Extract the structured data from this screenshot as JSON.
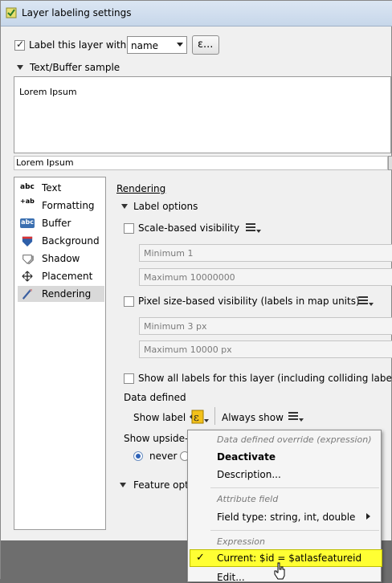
{
  "window": {
    "title": "Layer labeling settings"
  },
  "header": {
    "label_checkbox_text": "Label this layer with",
    "label_checked": true,
    "field_value": "name",
    "expression_button_label": "ε..."
  },
  "sample": {
    "section_title": "Text/Buffer sample",
    "text": "Lorem Ipsum",
    "line_text": "Lorem Ipsum"
  },
  "sidebar": {
    "items": [
      {
        "label": "Text",
        "icon": "text-icon",
        "icon_text": "abc"
      },
      {
        "label": "Formatting",
        "icon": "formatting-icon",
        "icon_text": "+ab"
      },
      {
        "label": "Buffer",
        "icon": "buffer-icon",
        "icon_text": "abc"
      },
      {
        "label": "Background",
        "icon": "background-icon"
      },
      {
        "label": "Shadow",
        "icon": "shadow-icon"
      },
      {
        "label": "Placement",
        "icon": "placement-icon"
      },
      {
        "label": "Rendering",
        "icon": "rendering-icon"
      }
    ],
    "selected": "Rendering"
  },
  "rendering": {
    "title": "Rendering",
    "label_options_title": "Label options",
    "scale_visibility": "Scale-based visibility",
    "scale_min_placeholder": "Minimum 1",
    "scale_max_placeholder": "Maximum 10000000",
    "pixel_visibility": "Pixel size-based visibility (labels in map units)",
    "pixel_min_placeholder": "Minimum 3 px",
    "pixel_max_placeholder": "Maximum 10000 px",
    "show_all_labels": "Show all labels for this layer (including colliding labels)",
    "data_defined_label": "Data defined",
    "show_label": "Show label",
    "always_show": "Always show",
    "upside_down_label": "Show upside-c",
    "radio_never": "never",
    "feature_options": "Feature optio"
  },
  "popup": {
    "header1": "Data defined override (expression)",
    "deactivate": "Deactivate",
    "description": "Description...",
    "header2": "Attribute field",
    "field_type": "Field type: string, int, double",
    "header3": "Expression",
    "current": "Current: $id = $atlasfeatureid",
    "edit": "Edit..."
  },
  "colors": {
    "highlight": "#ffff33",
    "accent": "#f0a000"
  }
}
